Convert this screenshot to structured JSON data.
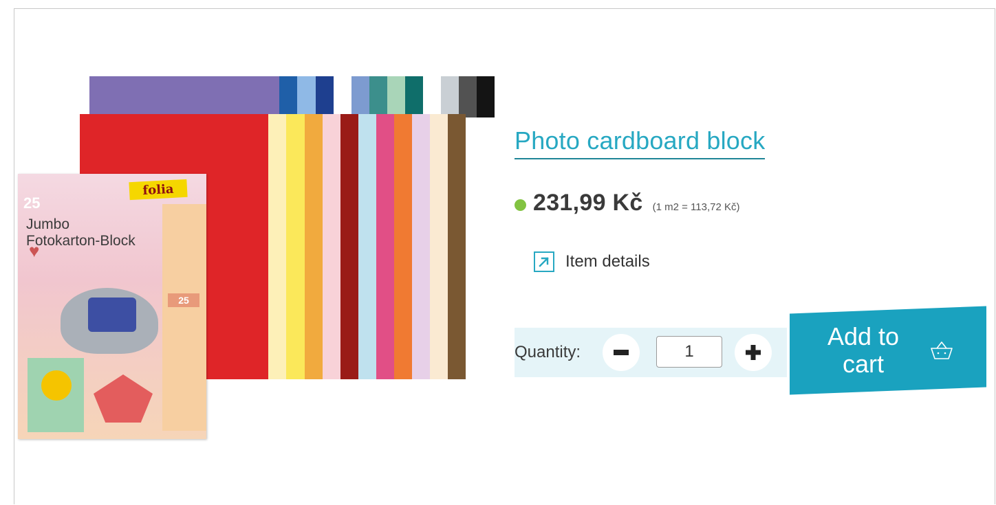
{
  "product": {
    "title": "Photo cardboard block",
    "price": "231,99 Kč",
    "unit_price": "(1 m2 = 113,72 Kč)",
    "stock_status_color": "#82c341",
    "details_label": "Item details",
    "details_icon": "external-arrow-icon"
  },
  "image": {
    "packaging_brand": "folia",
    "packaging_count": "25",
    "packaging_title_line1": "Jumbo",
    "packaging_title_line2": "Fotokarton-Block",
    "back_sheet_colors": [
      "#7f6fb3",
      "#1f5fa8",
      "#8fb9e6",
      "#1e3f8f",
      "#ffffff",
      "#7d9bd0",
      "#3c8f8c",
      "#a9d5b8",
      "#0f6e6a",
      "#ffffff",
      "#c9cfd4",
      "#525252",
      "#141414"
    ],
    "front_sheet_colors": [
      "#df2528",
      "#fdf0b8",
      "#fbe85a",
      "#f1aa3e",
      "#f8d2d8",
      "#9a1b17",
      "#bfe1ee",
      "#e14f86",
      "#f07a32",
      "#e7d0e8",
      "#faead2",
      "#7a5832"
    ]
  },
  "purchase": {
    "quantity_label": "Quantity:",
    "quantity_value": "1",
    "minus_icon": "minus-icon",
    "plus_icon": "plus-icon",
    "add_to_cart_label": "Add to cart",
    "cart_icon": "basket-icon",
    "accent_color": "#1aa2bf"
  }
}
